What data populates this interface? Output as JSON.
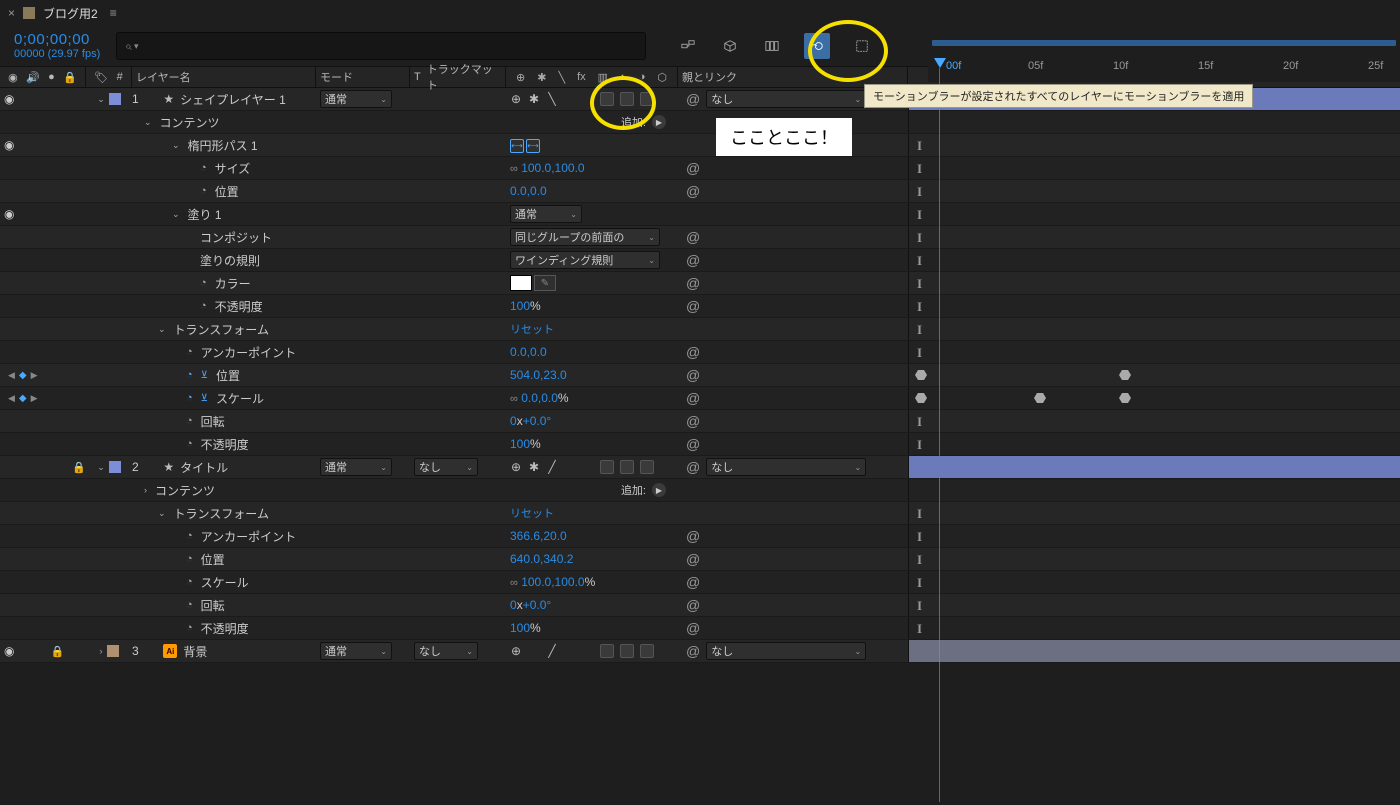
{
  "tab": {
    "title": "ブログ用2"
  },
  "timecode": {
    "value": "0;00;00;00",
    "frames_fps": "00000 (29.97 fps)"
  },
  "search": {
    "placeholder": ""
  },
  "ruler": {
    "ticks": [
      "00f",
      "05f",
      "10f",
      "15f",
      "20f",
      "25f"
    ]
  },
  "columns": {
    "layer_name": "レイヤー名",
    "mode": "モード",
    "track_matte_prefix": "T",
    "track_matte": "トラックマット",
    "parent_link": "親とリンク",
    "hash": "#"
  },
  "tooltip": "モーションブラーが設定されたすべてのレイヤーにモーションブラーを適用",
  "annotation": "こことここ！",
  "add_label": "追加:",
  "modes": {
    "normal": "通常"
  },
  "track_none": "なし",
  "parent_none": "なし",
  "layers": [
    {
      "idx": "1",
      "name": "シェイプレイヤー 1",
      "type": "shape"
    },
    {
      "idx": "2",
      "name": "タイトル",
      "type": "shape",
      "locked": true
    },
    {
      "idx": "3",
      "name": "背景",
      "type": "ai",
      "locked": true
    }
  ],
  "groups": {
    "contents": "コンテンツ",
    "ellipse_path": "楕円形パス 1",
    "fill": "塗り 1",
    "transform": "トランスフォーム"
  },
  "props": {
    "size": {
      "label": "サイズ",
      "value": "100.0,100.0"
    },
    "position_shape": {
      "label": "位置",
      "value": "0.0,0.0"
    },
    "composite": {
      "label": "コンポジット",
      "value": "同じグループの前面の"
    },
    "fill_rule": {
      "label": "塗りの規則",
      "value": "ワインディング規則"
    },
    "color": {
      "label": "カラー"
    },
    "opacity": {
      "label": "不透明度",
      "value": "100",
      "unit": "%"
    },
    "reset": {
      "label": "リセット"
    },
    "anchor": {
      "label": "アンカーポイント",
      "value": "0.0,0.0"
    },
    "position": {
      "label": "位置",
      "value": "504.0,23.0"
    },
    "scale": {
      "label": "スケール",
      "value": "0.0,0.0",
      "unit": "%"
    },
    "rotation": {
      "label": "回転",
      "value_prefix": "0",
      "x": "x",
      "value_deg": "+0.0°"
    },
    "opacity2": {
      "label": "不透明度",
      "value": "100",
      "unit": "%"
    },
    "anchor2": {
      "label": "アンカーポイント",
      "value": "366.6,20.0"
    },
    "position2": {
      "label": "位置",
      "value": "640.0,340.2"
    },
    "scale2": {
      "label": "スケール",
      "value": "100.0,100.0",
      "unit": "%"
    },
    "rotation2": {
      "label": "回転",
      "value_prefix": "0",
      "x": "x",
      "value_deg": "+0.0°"
    },
    "opacity3": {
      "label": "不透明度",
      "value": "100",
      "unit": "%"
    }
  }
}
